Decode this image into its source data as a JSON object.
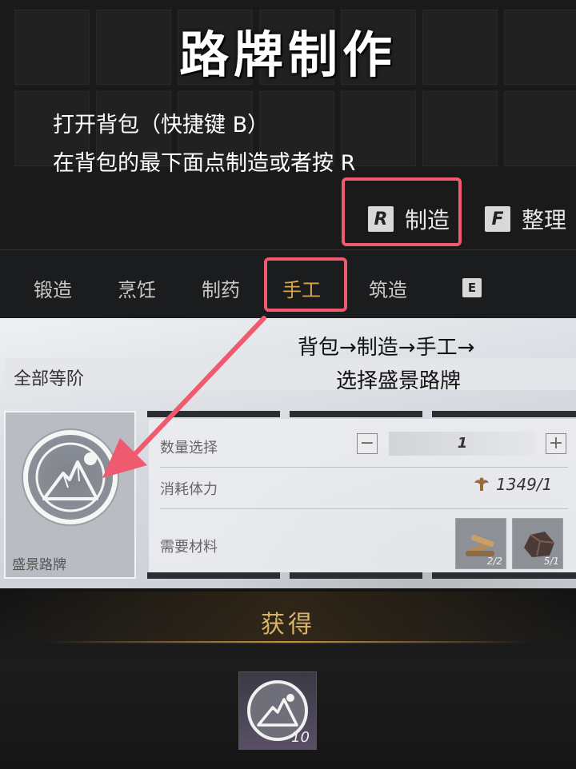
{
  "guide": {
    "title": "路牌制作",
    "instruction_1": "打开背包（快捷键 B）",
    "instruction_2": "在背包的最下面点制造或者按 R",
    "annotation_1": "背包→制造→手工→",
    "annotation_2": "选择盛景路牌",
    "highlight_color": "#f05a6e"
  },
  "inventory_actions": {
    "make_key": "R",
    "make_label": "制造",
    "sort_key": "F",
    "sort_label": "整理"
  },
  "tabs": [
    {
      "label": "锻造",
      "active": false
    },
    {
      "label": "烹饪",
      "active": false
    },
    {
      "label": "制药",
      "active": false
    },
    {
      "label": "手工",
      "active": true
    },
    {
      "label": "筑造",
      "active": false
    }
  ],
  "tab_next_key": "E",
  "accent_color": "#d9a64a",
  "crafting": {
    "tier_filter": "全部等阶",
    "recipe": {
      "name": "盛景路牌",
      "icon": "mountain-sign-icon"
    },
    "quantity_label": "数量选择",
    "quantity_value": "1",
    "stamina_label": "消耗体力",
    "stamina_value": "1349/1",
    "stamina_icon": "stamina-icon",
    "materials_label": "需要材料",
    "materials": [
      {
        "icon": "wood-icon",
        "count": "2/2"
      },
      {
        "icon": "ore-icon",
        "count": "5/1"
      }
    ]
  },
  "obtained": {
    "title": "获得",
    "item_icon": "mountain-sign-icon",
    "item_quantity": "10"
  }
}
